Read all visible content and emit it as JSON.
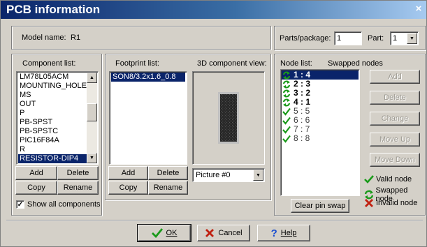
{
  "window": {
    "title": "PCB information",
    "close_glyph": "×"
  },
  "model": {
    "label": "Model name:",
    "value": "R1"
  },
  "component": {
    "label": "Component list:",
    "items": [
      "LM78L05ACM",
      "MOUNTING_HOLE",
      "MS",
      "OUT",
      "P",
      "PB-SPST",
      "PB-SPSTC",
      "PIC16F84A",
      "R",
      "RESISTOR-DIP4"
    ],
    "selected_index": 9,
    "buttons": {
      "add": "Add",
      "delete": "Delete",
      "copy": "Copy",
      "rename": "Rename"
    },
    "show_all_label": "Show all components",
    "show_all_checked": true
  },
  "footprint": {
    "label": "Footprint list:",
    "items": [
      "SON8/3.2x1.6_0.8"
    ],
    "selected_index": 0,
    "buttons": {
      "add": "Add",
      "delete": "Delete",
      "copy": "Copy",
      "rename": "Rename"
    }
  },
  "view3d": {
    "label": "3D component view:",
    "picture_value": "Picture #0"
  },
  "parts": {
    "label": "Parts/package:",
    "value": "1",
    "part_label": "Part:",
    "part_value": "1"
  },
  "nodes": {
    "label": "Node list:",
    "swapped_label": "Swapped nodes",
    "items": [
      {
        "text": "1 : 4",
        "status": "swapped"
      },
      {
        "text": "2 : 3",
        "status": "swapped"
      },
      {
        "text": "3 : 2",
        "status": "swapped"
      },
      {
        "text": "4 : 1",
        "status": "swapped"
      },
      {
        "text": "5 : 5",
        "status": "valid"
      },
      {
        "text": "6 : 6",
        "status": "valid"
      },
      {
        "text": "7 : 7",
        "status": "valid"
      },
      {
        "text": "8 : 8",
        "status": "valid"
      }
    ],
    "selected_index": 0,
    "buttons": {
      "add": "Add",
      "delete": "Delete",
      "change": "Change",
      "move_up": "Move Up",
      "move_down": "Move Down"
    },
    "clear_label": "Clear pin swap"
  },
  "legend": {
    "valid": "Valid node",
    "swapped": "Swapped node",
    "invalid": "Invalid node"
  },
  "footer": {
    "ok": "OK",
    "cancel": "Cancel",
    "help": "Help"
  },
  "colors": {
    "title_start": "#0a246a",
    "valid_green": "#1a9a1a",
    "invalid_red": "#c02010",
    "selection": "#0a246a"
  }
}
